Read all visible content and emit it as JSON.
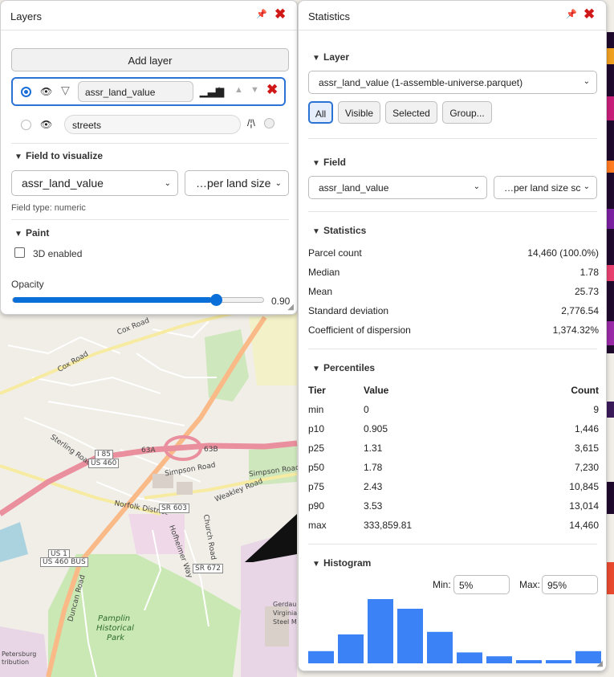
{
  "layers_panel": {
    "title": "Layers",
    "add_layer_label": "Add layer",
    "layers": [
      {
        "name": "assr_land_value",
        "selected": true
      },
      {
        "name": "streets",
        "selected": false
      }
    ],
    "field_section": "Field to visualize",
    "field_select": "assr_land_value",
    "normalize_select": "…per land size",
    "field_type": "Field type: numeric",
    "paint_section": "Paint",
    "enable_3d_label": "3D enabled",
    "opacity_label": "Opacity",
    "opacity_value": "0.90",
    "opacity_fraction": 0.9
  },
  "stats_panel": {
    "title": "Statistics",
    "layer_section": "Layer",
    "layer_select": "assr_land_value (1-assemble-universe.parquet)",
    "filter_buttons": [
      "All",
      "Visible",
      "Selected",
      "Group..."
    ],
    "active_filter": "All",
    "field_section": "Field",
    "field_select": "assr_land_value",
    "normalize_select": "…per land size sc",
    "statistics_section": "Statistics",
    "stats": [
      {
        "label": "Parcel count",
        "value": "14,460 (100.0%)"
      },
      {
        "label": "Median",
        "value": "1.78"
      },
      {
        "label": "Mean",
        "value": "25.73"
      },
      {
        "label": "Standard deviation",
        "value": "2,776.54"
      },
      {
        "label": "Coefficient of dispersion",
        "value": "1,374.32%"
      }
    ],
    "percentiles_section": "Percentiles",
    "percentile_headers": [
      "Tier",
      "Value",
      "Count"
    ],
    "percentiles": [
      {
        "tier": "min",
        "value": "0",
        "count": "9"
      },
      {
        "tier": "p10",
        "value": "0.905",
        "count": "1,446"
      },
      {
        "tier": "p25",
        "value": "1.31",
        "count": "3,615"
      },
      {
        "tier": "p50",
        "value": "1.78",
        "count": "7,230"
      },
      {
        "tier": "p75",
        "value": "2.43",
        "count": "10,845"
      },
      {
        "tier": "p90",
        "value": "3.53",
        "count": "13,014"
      },
      {
        "tier": "max",
        "value": "333,859.81",
        "count": "14,460"
      }
    ],
    "histogram_section": "Histogram",
    "min_label": "Min:",
    "min_value": "5%",
    "max_label": "Max:",
    "max_value": "95%",
    "bar_color": "#3b82f6",
    "histogram": [
      0.19,
      0.45,
      1.0,
      0.85,
      0.49,
      0.17,
      0.11,
      0.05,
      0.05,
      0.19
    ]
  },
  "map": {
    "labels": [
      "Cox Road",
      "Cox Road",
      "Sterling Road",
      "I 85",
      "US 460",
      "63A",
      "63B",
      "Simpson Road",
      "Simpson Road",
      "Weakley Road",
      "Norfolk District",
      "SR 603",
      "Hofheimer Way",
      "Church Road",
      "SR 672",
      "US 1",
      "US 460 BUS",
      "Duncan Road",
      "Pamplin",
      "Historical",
      "Park",
      "Petersburg",
      "tribution",
      "Gerdau",
      "Virginia",
      "Steel M"
    ]
  }
}
